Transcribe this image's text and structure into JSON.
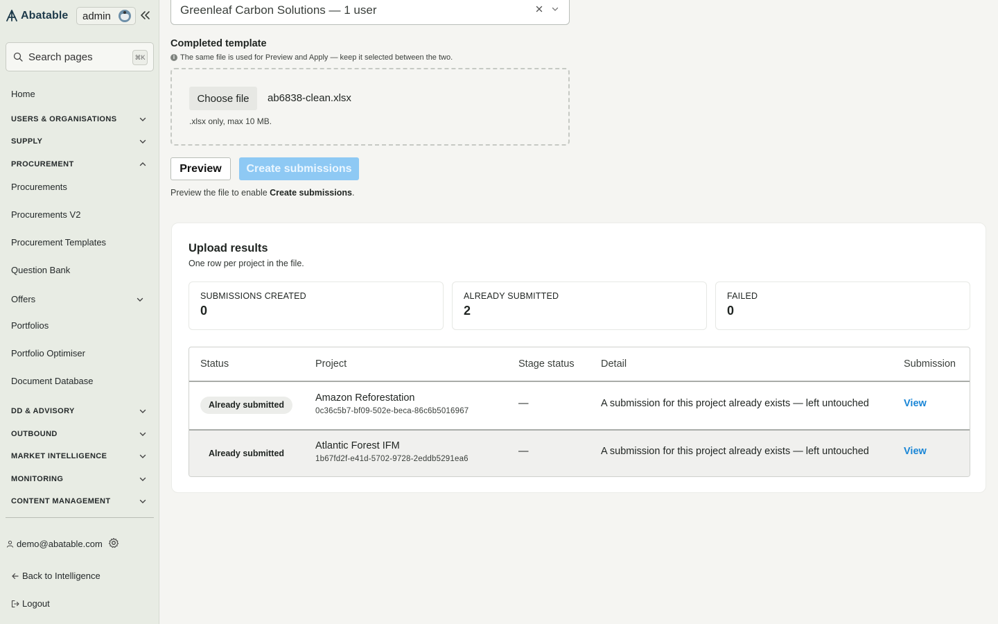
{
  "sidebar": {
    "brand": "Abatable",
    "admin_label": "admin",
    "search": {
      "label": "Search pages",
      "shortcut": "⌘K"
    },
    "items": [
      {
        "label": "Home",
        "type": "link"
      },
      {
        "label": "USERS & ORGANISATIONS",
        "type": "section",
        "expanded": false
      },
      {
        "label": "SUPPLY",
        "type": "section",
        "expanded": false
      },
      {
        "label": "PROCUREMENT",
        "type": "section",
        "expanded": true
      },
      {
        "label": "Procurements",
        "type": "link"
      },
      {
        "label": "Procurements V2",
        "type": "link"
      },
      {
        "label": "Procurement Templates",
        "type": "link"
      },
      {
        "label": "Question Bank",
        "type": "link"
      },
      {
        "label": "Offers",
        "type": "link",
        "expandable": true
      },
      {
        "label": "Portfolios",
        "type": "link"
      },
      {
        "label": "Portfolio Optimiser",
        "type": "link"
      },
      {
        "label": "Document Database",
        "type": "link"
      },
      {
        "label": "DD & ADVISORY",
        "type": "section",
        "expanded": false
      },
      {
        "label": "OUTBOUND",
        "type": "section",
        "expanded": false
      },
      {
        "label": "MARKET INTELLIGENCE",
        "type": "section",
        "expanded": false
      },
      {
        "label": "MONITORING",
        "type": "section",
        "expanded": false
      },
      {
        "label": "CONTENT MANAGEMENT",
        "type": "section",
        "expanded": false
      }
    ],
    "user_email": "demo@abatable.com",
    "back_link": "Back to Intelligence",
    "logout": "Logout"
  },
  "main": {
    "org_select": {
      "value": "Greenleaf Carbon Solutions — 1 user"
    },
    "template": {
      "title": "Completed template",
      "hint": "The same file is used for Preview and Apply — keep it selected between the two.",
      "choose_file_label": "Choose file",
      "file_name": "ab6838-clean.xlsx",
      "file_hint": ".xlsx only, max 10 MB."
    },
    "actions": {
      "preview_label": "Preview",
      "create_label": "Create submissions",
      "hint_prefix": "Preview the file to enable ",
      "hint_bold": "Create submissions",
      "hint_suffix": "."
    },
    "results": {
      "title": "Upload results",
      "subtitle": "One row per project in the file.",
      "stats": [
        {
          "label": "SUBMISSIONS CREATED",
          "value": "0"
        },
        {
          "label": "ALREADY SUBMITTED",
          "value": "2"
        },
        {
          "label": "FAILED",
          "value": "0"
        }
      ],
      "columns": [
        "Status",
        "Project",
        "Stage status",
        "Detail",
        "Submission"
      ],
      "rows": [
        {
          "status": "Already submitted",
          "project": "Amazon Reforestation",
          "project_id": "0c36c5b7-bf09-502e-beca-86c6b5016967",
          "stage": "—",
          "detail": "A submission for this project already exists — left untouched",
          "link": "View"
        },
        {
          "status": "Already submitted",
          "project": "Atlantic Forest IFM",
          "project_id": "1b67fd2f-e41d-5702-9728-2eddb5291ea6",
          "stage": "—",
          "detail": "A submission for this project already exists — left untouched",
          "link": "View"
        }
      ]
    }
  },
  "colors": {
    "sidebar_bg": "#e8ece4",
    "page_bg": "#f5f5f2",
    "primary_disabled": "#8ec9f4",
    "link": "#1a86d6"
  }
}
